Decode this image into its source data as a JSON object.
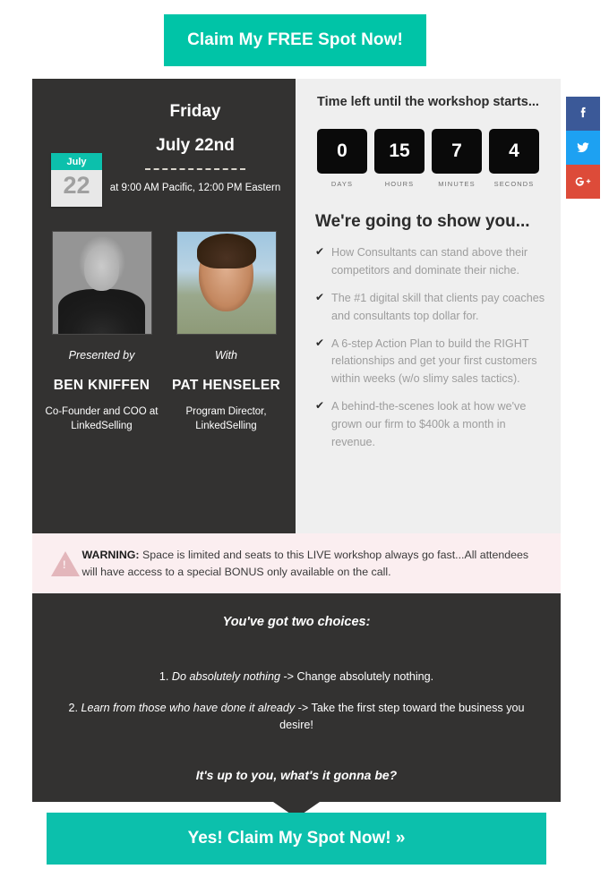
{
  "top_cta": {
    "label": "Claim My FREE Spot Now!",
    "color": "#00c4a7"
  },
  "event": {
    "calendar": {
      "month": "July",
      "day": "22"
    },
    "day_of_week": "Friday",
    "date": "July 22nd",
    "time": "at 9:00 AM Pacific, 12:00 PM Eastern"
  },
  "presenters": [
    {
      "prefix": "Presented by",
      "name": "BEN KNIFFEN",
      "title": "Co-Founder and COO at LinkedSelling",
      "photo": "ben-kniffen-photo"
    },
    {
      "prefix": "With",
      "name": "PAT HENSELER",
      "title": "Program Director, LinkedSelling",
      "photo": "pat-henseler-photo"
    }
  ],
  "countdown": {
    "heading": "Time left until the workshop starts...",
    "units": [
      {
        "value": "0",
        "label": "DAYS"
      },
      {
        "value": "15",
        "label": "HOURS"
      },
      {
        "value": "7",
        "label": "MINUTES"
      },
      {
        "value": "4",
        "label": "SECONDS"
      }
    ]
  },
  "agenda": {
    "title": "We're going to show you...",
    "bullets": [
      "How Consultants can stand above their competitors and dominate their niche.",
      "The #1 digital skill that clients pay coaches and consultants top dollar for.",
      "A 6-step Action Plan to build the RIGHT relationships and get your first customers within weeks (w/o slimy sales tactics).",
      "A behind-the-scenes look at how we've grown our firm to $400k a month in revenue."
    ],
    "check_glyph": "✔"
  },
  "warning": {
    "icon": "warning-triangle-icon",
    "label": "WARNING:",
    "text": " Space is limited and seats to this LIVE workshop always go fast...All attendees will have access to a special BONUS only available on the call.",
    "bg": "#fbeef0"
  },
  "choices": {
    "heading": "You've got two choices:",
    "items": [
      {
        "num": "1. ",
        "em": "Do absolutely nothing",
        "rest": " -> Change absolutely nothing."
      },
      {
        "num": "2. ",
        "em": "Learn from those who have done it already",
        "rest": " -> Take the first step toward the business you desire!"
      }
    ],
    "footer": "It's up to you, what's it gonna be?"
  },
  "bottom_cta": {
    "label": "Yes! Claim My Spot Now! »",
    "color": "#0cc0ac"
  },
  "social": [
    {
      "name": "facebook-share-button",
      "glyph": "f",
      "color": "#3b5998"
    },
    {
      "name": "twitter-share-button",
      "glyph": "t",
      "color": "#1da1f2"
    },
    {
      "name": "google-plus-share-button",
      "glyph": "G+",
      "color": "#dd4b39"
    }
  ]
}
